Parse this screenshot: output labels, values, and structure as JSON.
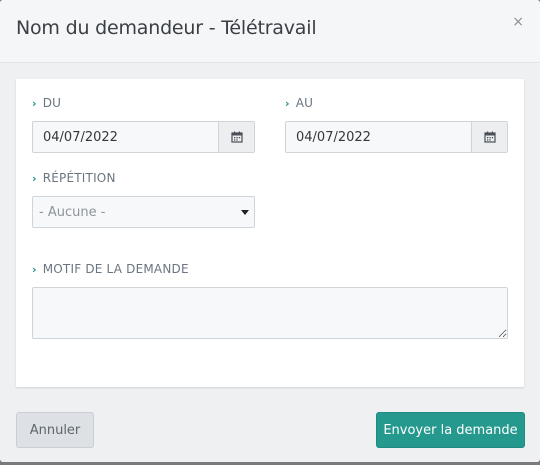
{
  "dialog": {
    "title": "Nom du demandeur - Télétravail",
    "close_label": "×"
  },
  "form": {
    "from": {
      "label": "DU",
      "value": "04/07/2022"
    },
    "to": {
      "label": "AU",
      "value": "04/07/2022"
    },
    "repetition": {
      "label": "RÉPÉTITION",
      "selected": "- Aucune -"
    },
    "reason": {
      "label": "MOTIF DE LA DEMANDE",
      "value": ""
    }
  },
  "footer": {
    "cancel_label": "Annuler",
    "submit_label": "Envoyer la demande"
  },
  "colors": {
    "accent": "#26998f",
    "chevron": "#1e8f86"
  },
  "icons": {
    "date_picker": "calendar-icon",
    "label_marker": "chevron-right-icon",
    "select_toggle": "caret-down-icon"
  }
}
